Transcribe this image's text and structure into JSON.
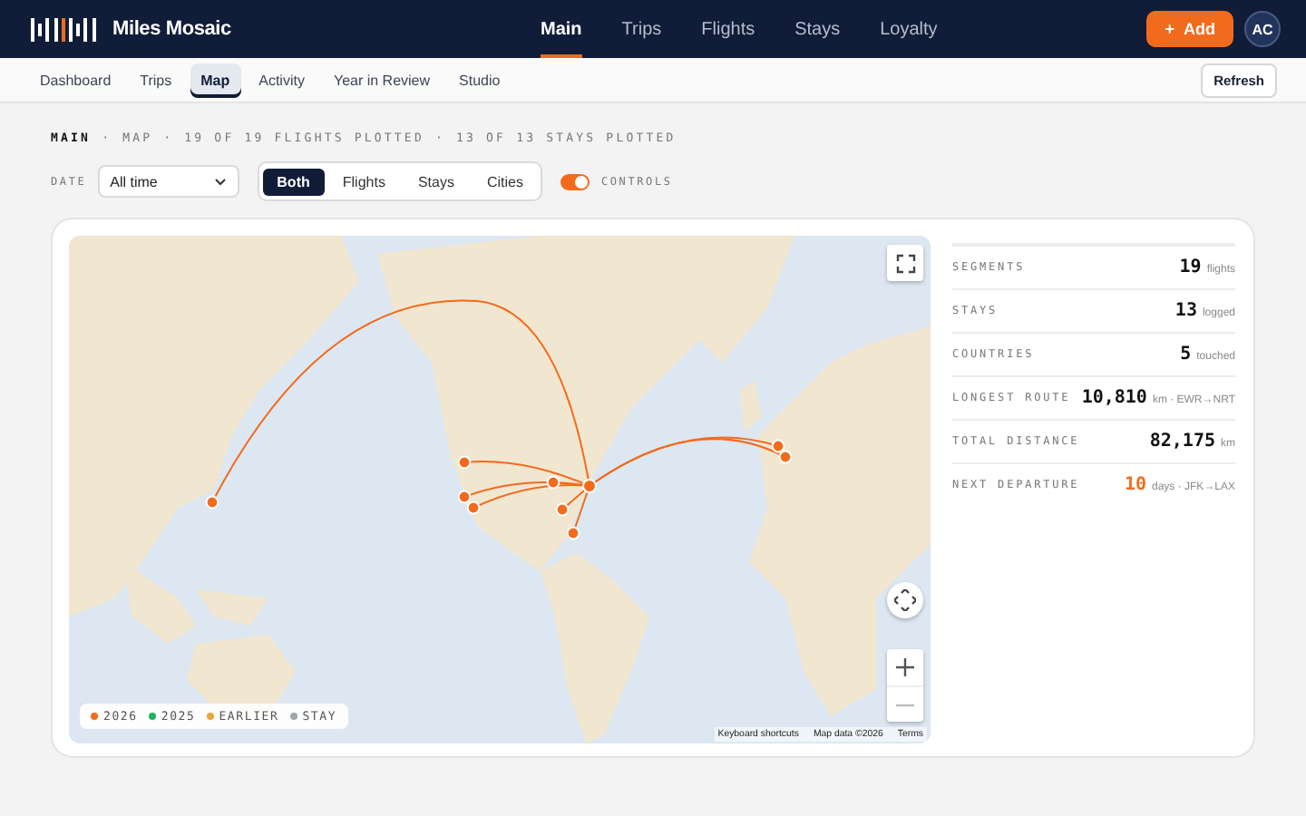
{
  "brand": {
    "name": "Miles Mosaic"
  },
  "main_nav": [
    {
      "label": "Main",
      "selected": true
    },
    {
      "label": "Trips",
      "selected": false
    },
    {
      "label": "Flights",
      "selected": false
    },
    {
      "label": "Stays",
      "selected": false
    },
    {
      "label": "Loyalty",
      "selected": false
    }
  ],
  "add_button": {
    "icon": "+",
    "label": "Add"
  },
  "avatar": {
    "initials": "AC"
  },
  "sub_nav": [
    {
      "label": "Dashboard",
      "selected": false
    },
    {
      "label": "Trips",
      "selected": false
    },
    {
      "label": "Map",
      "selected": true
    },
    {
      "label": "Activity",
      "selected": false
    },
    {
      "label": "Year in Review",
      "selected": false
    },
    {
      "label": "Studio",
      "selected": false
    }
  ],
  "refresh_button": "Refresh",
  "breadcrumb": {
    "section": "MAIN",
    "separator": "·",
    "page": "MAP",
    "flights": "19 OF 19 FLIGHTS PLOTTED",
    "stays": "13 OF 13 STAYS PLOTTED"
  },
  "filters": {
    "date_label": "DATE",
    "date_value": "All time",
    "segments": [
      {
        "label": "Both",
        "selected": true
      },
      {
        "label": "Flights",
        "selected": false
      },
      {
        "label": "Stays",
        "selected": false
      },
      {
        "label": "Cities",
        "selected": false
      }
    ],
    "controls_toggle": {
      "label": "CONTROLS",
      "on": true
    }
  },
  "map": {
    "legend": [
      {
        "label": "2026",
        "color": "#f26b1d"
      },
      {
        "label": "2025",
        "color": "#22b35e"
      },
      {
        "label": "EARLIER",
        "color": "#e8a838"
      },
      {
        "label": "STAY",
        "color": "#a0a4ab"
      }
    ],
    "attribution": [
      "Keyboard shortcuts",
      "Map data ©2026",
      "Terms"
    ]
  },
  "stats": [
    {
      "label": "SEGMENTS",
      "value": "19",
      "unit": "flights",
      "highlight": false
    },
    {
      "label": "STAYS",
      "value": "13",
      "unit": "logged",
      "highlight": false
    },
    {
      "label": "COUNTRIES",
      "value": "5",
      "unit": "touched",
      "highlight": false
    },
    {
      "label": "LONGEST ROUTE",
      "value": "10,810",
      "unit": "km · EWR→NRT",
      "highlight": false
    },
    {
      "label": "TOTAL DISTANCE",
      "value": "82,175",
      "unit": "km",
      "highlight": false
    },
    {
      "label": "NEXT DEPARTURE",
      "value": "10",
      "unit": "days · JFK→LAX",
      "highlight": true
    }
  ]
}
